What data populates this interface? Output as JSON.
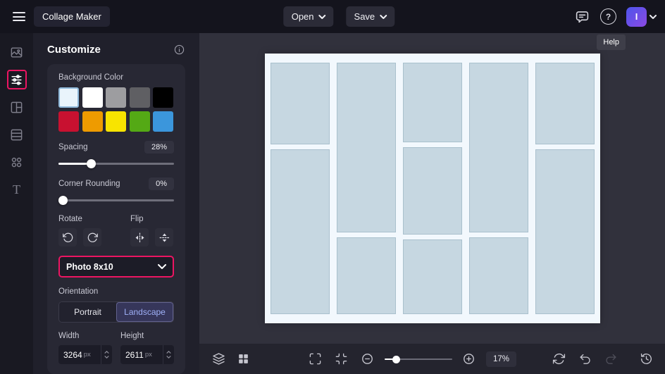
{
  "colors": {
    "accent": "#ec1562",
    "topbar_bg": "#14141d",
    "rail_bg": "#191922",
    "panel_bg": "#20202b",
    "card_bg": "#282834",
    "canvas_bg": "#31313c",
    "toolbar_bg": "#24242e",
    "collage_bg": "#f2f8fd",
    "collage_cell": "#c6d7e1",
    "collage_cell_border": "#a9c0cd",
    "avatar_from": "#4d55ec",
    "avatar_to": "#8c49e2",
    "orientation_selected_bg": "#36365a",
    "orientation_selected_text": "#9fb0f8"
  },
  "topbar": {
    "title": "Collage Maker",
    "open_label": "Open",
    "save_label": "Save",
    "avatar_initial": "I",
    "help_glyph": "?",
    "icons": [
      "hamburger-icon",
      "feedback-icon",
      "help-icon",
      "chevron-down-icon"
    ]
  },
  "tooltip": {
    "text": "Help"
  },
  "rail": {
    "items": [
      {
        "icon": "image-manager-icon",
        "selected": false
      },
      {
        "icon": "customize-sliders-icon",
        "selected": true
      },
      {
        "icon": "layouts-icon",
        "selected": false
      },
      {
        "icon": "patterns-icon",
        "selected": false
      },
      {
        "icon": "graphics-icon",
        "selected": false
      },
      {
        "icon": "text-icon",
        "selected": false
      }
    ],
    "text_glyph": "T"
  },
  "panel": {
    "title": "Customize",
    "background_color_label": "Background Color",
    "swatch_rows": [
      [
        "#e9f4fb",
        "#ffffff",
        "#9d9da0",
        "#5f5f63",
        "#000000"
      ],
      [
        "#c81130",
        "#ee9b00",
        "#f8e400",
        "#54a915",
        "#3b96dc"
      ]
    ],
    "selected_swatch_row": 0,
    "selected_swatch_index": 0,
    "spacing_label": "Spacing",
    "spacing_value": "28%",
    "spacing_percent": 28,
    "corner_label": "Corner Rounding",
    "corner_value": "0%",
    "corner_percent": 0,
    "rotate_label": "Rotate",
    "flip_label": "Flip",
    "rotate_icons": [
      "rotate-ccw-icon",
      "rotate-cw-icon"
    ],
    "flip_icons": [
      "flip-horizontal-icon",
      "flip-vertical-icon"
    ],
    "size_preset_value": "Photo 8x10",
    "orientation_label": "Orientation",
    "portrait_label": "Portrait",
    "landscape_label": "Landscape",
    "selected_orientation": "Landscape",
    "width_label": "Width",
    "width_value": "3264",
    "height_label": "Height",
    "height_value": "2611",
    "unit": "px"
  },
  "canvas": {
    "collage_columns": [
      [
        33,
        67
      ],
      [
        69,
        31
      ],
      [
        33,
        36,
        31
      ],
      [
        69,
        31
      ],
      [
        33,
        67
      ]
    ]
  },
  "toolbar": {
    "zoom_value": "17%",
    "zoom_percent": 17,
    "left_icons": [
      "layers-icon",
      "grid-icon"
    ],
    "right_icons": [
      "expand-icon",
      "fit-screen-icon",
      "zoom-out-icon",
      "zoom-in-icon",
      "reset-zoom-icon",
      "undo-icon",
      "redo-icon",
      "history-icon"
    ]
  }
}
